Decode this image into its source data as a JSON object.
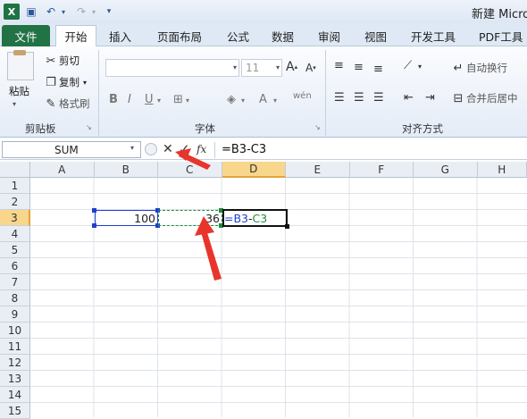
{
  "window": {
    "title": "新建 Micro"
  },
  "tabs": [
    "文件",
    "开始",
    "插入",
    "页面布局",
    "公式",
    "数据",
    "审阅",
    "视图",
    "开发工具",
    "PDF工具"
  ],
  "clipboard": {
    "paste": "粘贴",
    "cut": "剪切",
    "copy": "复制",
    "format_painter": "格式刷",
    "group": "剪贴板"
  },
  "font": {
    "name": "",
    "size": "11",
    "group": "字体"
  },
  "alignment": {
    "wrap": "自动换行",
    "merge": "合并后居中",
    "group": "对齐方式"
  },
  "formula_bar": {
    "name_box": "SUM",
    "cancel": "✕",
    "enter": "✓",
    "fx": "fx",
    "formula": "=B3-C3"
  },
  "columns": [
    "A",
    "B",
    "C",
    "D",
    "E",
    "F",
    "G",
    "H"
  ],
  "rows": [
    "1",
    "2",
    "3",
    "4",
    "5",
    "6",
    "7",
    "8",
    "9",
    "10",
    "11",
    "12",
    "13",
    "14",
    "15"
  ],
  "cells": {
    "B3": "100",
    "C3": "36",
    "D3_ref1": "=B3",
    "D3_op": "-",
    "D3_ref2": "C3"
  },
  "colors": {
    "accent": "#217346",
    "ref_blue": "#1f3fd1",
    "ref_green": "#1e8c3a",
    "arrow": "#e8352b"
  }
}
